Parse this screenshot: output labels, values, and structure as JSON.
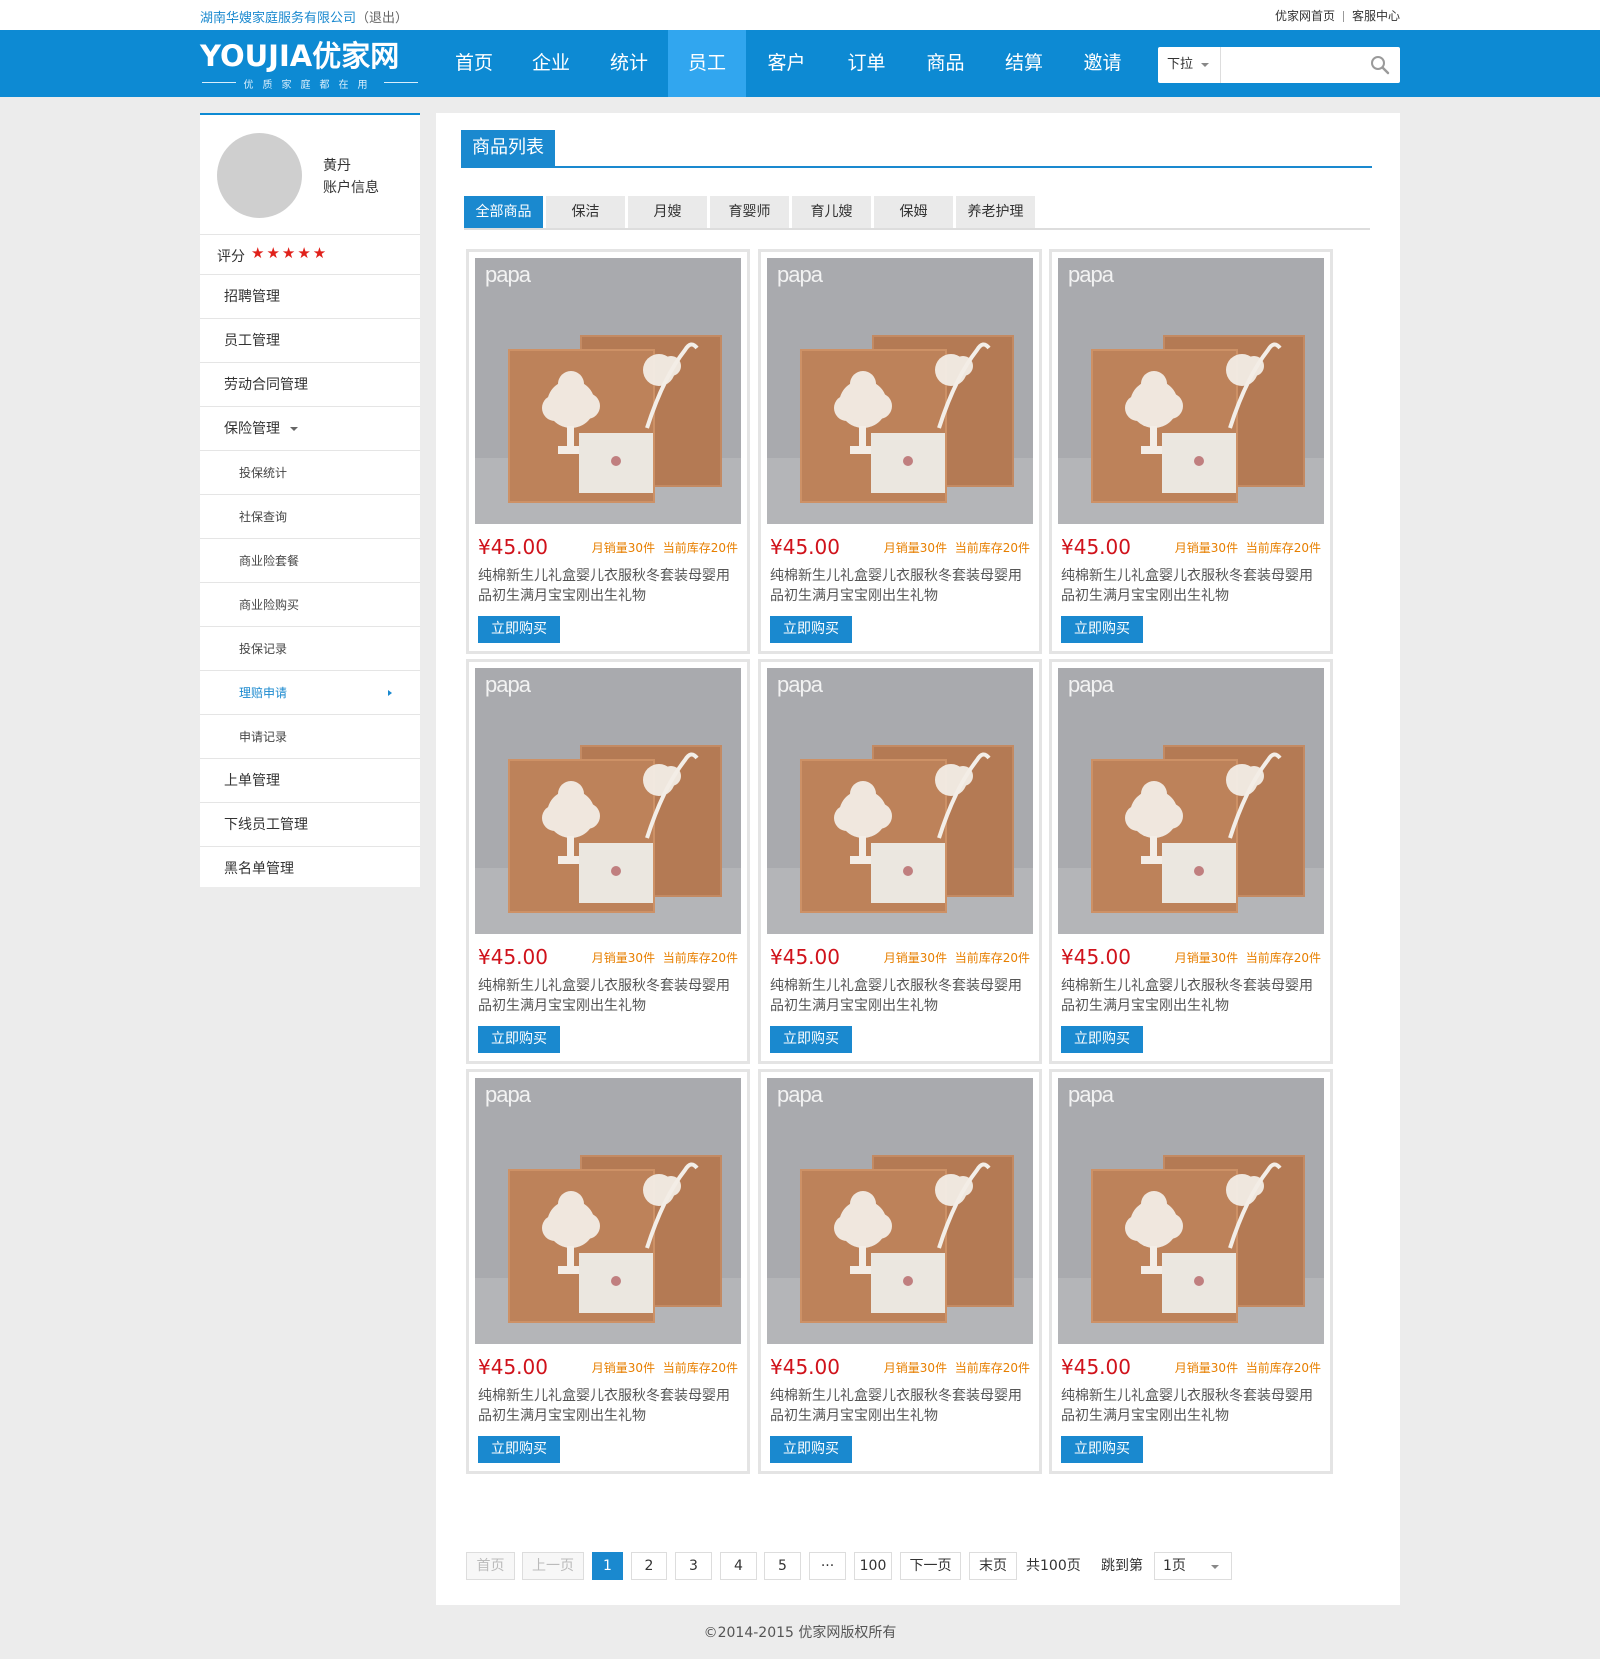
{
  "topbar": {
    "company": "湖南华嫂家庭服务有限公司",
    "logout": "（退出）",
    "link_home": "优家网首页",
    "link_service": "客服中心"
  },
  "header": {
    "logo_text": "YOUJIA优家网",
    "logo_slogan": "优质家庭都在用",
    "menu": [
      "首页",
      "企业",
      "统计",
      "员工",
      "客户",
      "订单",
      "商品",
      "结算",
      "邀请"
    ],
    "active_menu": "员工",
    "search": {
      "select_label": "下拉",
      "placeholder": ""
    }
  },
  "sidebar": {
    "user_name": "黄丹",
    "account_info": "账户信息",
    "rating_label": "评分",
    "rating_stars": "★★★★★",
    "rating_value": 5,
    "items": [
      {
        "label": "招聘管理"
      },
      {
        "label": "员工管理"
      },
      {
        "label": "劳动合同管理"
      },
      {
        "label": "保险管理"
      },
      {
        "label": "投保统计"
      },
      {
        "label": "社保查询"
      },
      {
        "label": "商业险套餐"
      },
      {
        "label": "商业险购买"
      },
      {
        "label": "投保记录"
      },
      {
        "label": "理赔申请"
      },
      {
        "label": "申请记录"
      },
      {
        "label": "上单管理"
      },
      {
        "label": "下线员工管理"
      },
      {
        "label": "黑名单管理"
      }
    ]
  },
  "main": {
    "title": "商品列表",
    "tabs": [
      "全部商品",
      "保洁",
      "月嫂",
      "育婴师",
      "育儿嫂",
      "保姆",
      "养老护理"
    ],
    "product": {
      "image_brand": "papa",
      "price": "¥45.00",
      "monthly_sales": "月销量30件",
      "stock": "当前库存20件",
      "name": "纯棉新生儿礼盒婴儿衣服秋冬套装母婴用品初生满月宝宝刚出生礼物",
      "buy_label": "立即购买"
    },
    "pagination": {
      "first": "首页",
      "prev": "上一页",
      "pages": [
        "1",
        "2",
        "3",
        "4",
        "5",
        "···",
        "100"
      ],
      "current": "1",
      "next": "下一页",
      "last": "末页",
      "total": "共100页",
      "jump_label": "跳到第",
      "jump_value": "1页"
    }
  },
  "footer": {
    "copyright": "©2014-2015 优家网版权所有"
  },
  "colors": {
    "primary": "#0d8ad3",
    "price": "#d0121b",
    "stats": "#e77f00",
    "star": "#e0211b"
  }
}
